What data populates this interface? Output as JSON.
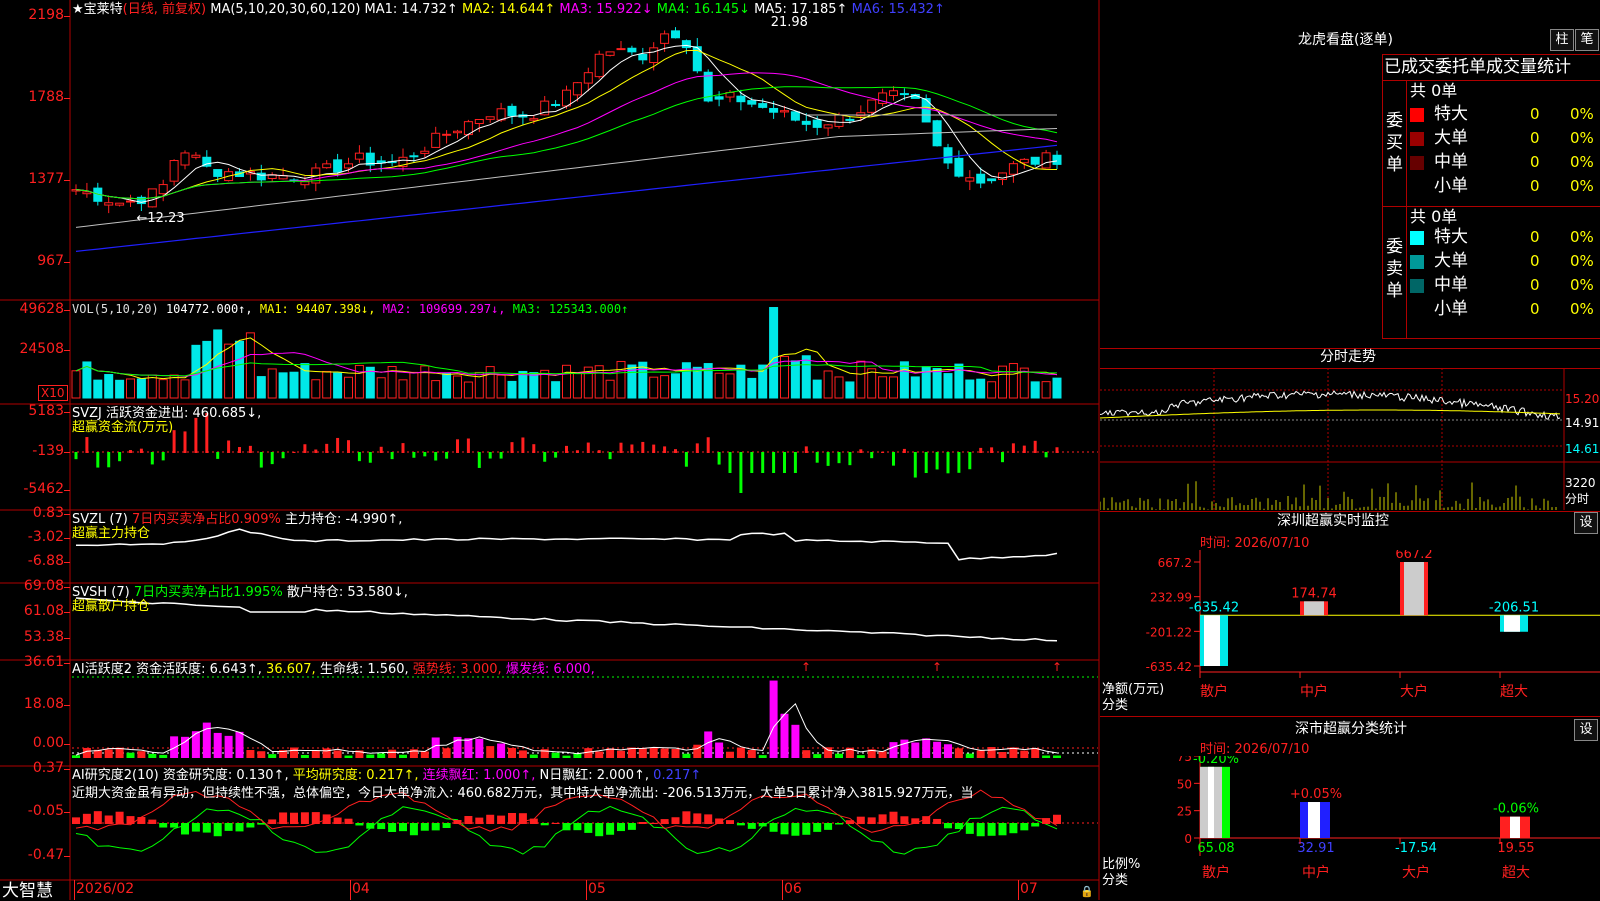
{
  "colors": {
    "up": "#ff2020",
    "down": "#00e8e8",
    "frame": "#b00000",
    "yellow": "#ffff00",
    "magenta": "#ff00ff",
    "green": "#00ff00",
    "white": "#ffffff",
    "blue": "#2020ff",
    "gray": "#a0a0a0"
  },
  "main": {
    "star_icon": "★",
    "stock_name": "宝莱特",
    "period_label": "(日线, 前复权)",
    "ma_label": "MA(5,10,20,30,60,120)",
    "ma_items": [
      {
        "label": "MA1: 14.732↑",
        "color": "#ffffff"
      },
      {
        "label": "MA2: 14.644↑",
        "color": "#ffff00"
      },
      {
        "label": "MA3: 15.922↓",
        "color": "#ff00ff"
      },
      {
        "label": "MA4: 16.145↓",
        "color": "#00ff00"
      },
      {
        "label": "MA5: 17.185↑",
        "color": "#ffffff"
      },
      {
        "label": "MA6: 15.432↑",
        "color": "#4040ff"
      }
    ],
    "price_ticks": [
      "2198",
      "1788",
      "1377",
      "967"
    ],
    "high_mark": "21.98",
    "low_mark": "12.23"
  },
  "vol": {
    "label": "VOL(5,10,20)",
    "value": "104772.000↑,",
    "items": [
      {
        "label": "MA1: 94407.398↓,",
        "color": "#ffff00"
      },
      {
        "label": "MA2: 109699.297↓,",
        "color": "#ff00ff"
      },
      {
        "label": "MA3: 125343.000↑",
        "color": "#00ff00"
      }
    ],
    "ticks": [
      "49628",
      "24508"
    ],
    "unit": "X10"
  },
  "svzj": {
    "label": "SVZJ  活跃资金进出: 460.685↓,",
    "sub": "超赢资金流(万元)",
    "ticks": [
      "5183",
      "-139",
      "-5462"
    ]
  },
  "svzl": {
    "label": "SVZL (7)",
    "l2": "7日内买卖净占比0.909%",
    "l3": "主力持仓: -4.990↑,",
    "sub": "超赢主力持仓",
    "ticks": [
      "0.83",
      "-3.02",
      "-6.88"
    ]
  },
  "svsh": {
    "label": "SVSH (7)",
    "l2": "7日内买卖净占比1.995%",
    "l3": "散户持仓: 53.580↓,",
    "sub": "超赢散户持仓",
    "ticks": [
      "69.08",
      "61.08",
      "53.38"
    ]
  },
  "ai1": {
    "label": "AI活跃度2",
    "l2": "资金活跃度: 6.643↑,",
    "l3": "36.607,",
    "l4": "生命线: 1.560,",
    "l5": "强势线: 3.000,",
    "l6": "爆发线: 6.000,",
    "ticks": [
      "36.61",
      "18.08",
      "0.00"
    ]
  },
  "ai2": {
    "label": "AI研究度2(10)",
    "l2": "资金研究度: 0.130↑,",
    "l3": "平均研究度: 0.217↑,",
    "l4": "连续飘红: 1.000↑,",
    "l5": "N日飘红: 2.000↑,",
    "l6": "0.217↑",
    "comment": "近期大资金虽有异动，但持续性不强，总体偏空，今日大单净流入: 460.682万元，其中特大单净流出: -206.513万元，大单5日累计净入3815.927万元，当",
    "ticks": [
      "0.37",
      "-0.05",
      "-0.47"
    ]
  },
  "xaxis": {
    "labels": [
      "2026/02",
      "04",
      "05",
      "06",
      "07"
    ],
    "brand": "大智慧"
  },
  "dragon": {
    "title": "龙虎看盘(逐单)",
    "btn1": "柱",
    "btn2": "笔",
    "tabs": "已成交委托单成交量统计",
    "buy_side": "委买单",
    "sell_side": "委卖单",
    "buy_total": "共 0单",
    "sell_total": "共 0单",
    "buy_rows": [
      {
        "name": "特大",
        "color": "#ff0000",
        "n": "0",
        "p": "0%"
      },
      {
        "name": "大单",
        "color": "#990000",
        "n": "0",
        "p": "0%"
      },
      {
        "name": "中单",
        "color": "#660000",
        "n": "0",
        "p": "0%"
      },
      {
        "name": "小单",
        "color": "",
        "n": "0",
        "p": "0%"
      }
    ],
    "sell_rows": [
      {
        "name": "特大",
        "color": "#00ffff",
        "n": "0",
        "p": "0%"
      },
      {
        "name": "大单",
        "color": "#009999",
        "n": "0",
        "p": "0%"
      },
      {
        "name": "中单",
        "color": "#006666",
        "n": "0",
        "p": "0%"
      },
      {
        "name": "小单",
        "color": "",
        "n": "0",
        "p": "0%"
      }
    ]
  },
  "minute": {
    "title": "分时走势",
    "ticks": [
      "15.20",
      "14.91",
      "14.61"
    ],
    "vol_tick": "3220",
    "vol_label": "分时"
  },
  "sz_monitor": {
    "title": "深圳超赢实时监控",
    "gear": "设",
    "time": "时间: 2026/07/10",
    "ticks": [
      "667.2",
      "232.99",
      "-201.22",
      "-635.42"
    ],
    "side_label1": "净额(万元)",
    "side_label2": "分类",
    "bars": [
      {
        "cat": "散户",
        "value": -635.42,
        "label": "-635.42"
      },
      {
        "cat": "中户",
        "value": 174.74,
        "label": "174.74"
      },
      {
        "cat": "大户",
        "value": 667.2,
        "label": "667.2"
      },
      {
        "cat": "超大",
        "value": -206.51,
        "label": "-206.51"
      }
    ]
  },
  "sz_class": {
    "title": "深市超赢分类统计",
    "gear": "设",
    "time": "时间: 2026/07/10",
    "ticks": [
      "75",
      "50",
      "25",
      "0"
    ],
    "side_label1": "比例%",
    "side_label2": "分类",
    "bars": [
      {
        "cat": "散户",
        "value": 65.08,
        "label": "65.08",
        "change": "-0.20%",
        "change_color": "#00ff00",
        "fill": "gray_green"
      },
      {
        "cat": "中户",
        "value": 32.91,
        "label": "32.91",
        "change": "+0.05%",
        "change_color": "#ff2020",
        "fill": "blue"
      },
      {
        "cat": "大户",
        "value": -17.54,
        "label": "-17.54",
        "change": "",
        "change_color": "#ff2020",
        "fill": "none"
      },
      {
        "cat": "超大",
        "value": 19.55,
        "label": "19.55",
        "change": "-0.06%",
        "change_color": "#00ff00",
        "fill": "red"
      }
    ]
  }
}
